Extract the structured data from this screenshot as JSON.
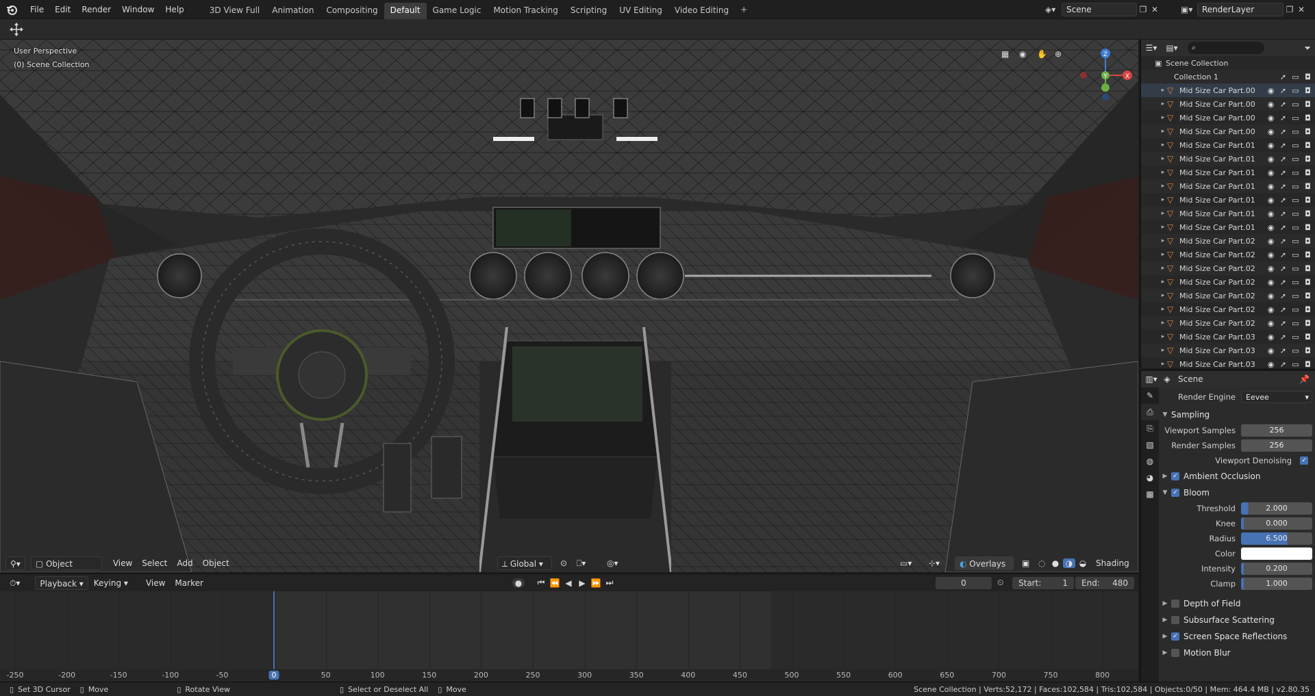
{
  "menu": [
    "File",
    "Edit",
    "Render",
    "Window",
    "Help"
  ],
  "workspaces": [
    {
      "label": "3D View Full",
      "active": false
    },
    {
      "label": "Animation",
      "active": false
    },
    {
      "label": "Compositing",
      "active": false
    },
    {
      "label": "Default",
      "active": true
    },
    {
      "label": "Game Logic",
      "active": false
    },
    {
      "label": "Motion Tracking",
      "active": false
    },
    {
      "label": "Scripting",
      "active": false
    },
    {
      "label": "UV Editing",
      "active": false
    },
    {
      "label": "Video Editing",
      "active": false
    }
  ],
  "workspace_add": "+",
  "scene": {
    "name": "Scene",
    "render_layer": "RenderLayer"
  },
  "viewport": {
    "perspective_label": "User Perspective",
    "collection_label": "(0) Scene Collection",
    "mode": "Object Mode",
    "menus": [
      "View",
      "Select",
      "Add",
      "Object"
    ],
    "orientation": "Global",
    "overlays_label": "Overlays",
    "shading_label": "Shading",
    "gizmo_axes": {
      "x": "X",
      "y": "Y",
      "z": "Z"
    }
  },
  "timeline": {
    "menus": [
      "Playback",
      "Keying",
      "View",
      "Marker"
    ],
    "current_frame": "0",
    "start_label": "Start:",
    "start": "1",
    "end_label": "End:",
    "end": "480",
    "ruler": [
      "-250",
      "-200",
      "-150",
      "-100",
      "-50",
      "0",
      "50",
      "100",
      "150",
      "200",
      "250",
      "300",
      "350",
      "400",
      "450",
      "500",
      "550",
      "600",
      "650",
      "700",
      "750",
      "800"
    ],
    "playhead_frame": 0
  },
  "status": {
    "items": [
      "Set 3D Cursor",
      "Move",
      "Rotate View",
      "Select or Deselect All",
      "Move"
    ],
    "stats": "Scene Collection | Verts:52,172 | Faces:102,584 | Tris:102,584 | Objects:0/50 | Mem: 464.4 MB | v2.80.35"
  },
  "outliner": {
    "root": "Scene Collection",
    "collection": "Collection 1",
    "objects": [
      "Mid Size Car Part.00",
      "Mid Size Car Part.00",
      "Mid Size Car Part.00",
      "Mid Size Car Part.00",
      "Mid Size Car Part.01",
      "Mid Size Car Part.01",
      "Mid Size Car Part.01",
      "Mid Size Car Part.01",
      "Mid Size Car Part.01",
      "Mid Size Car Part.01",
      "Mid Size Car Part.01",
      "Mid Size Car Part.02",
      "Mid Size Car Part.02",
      "Mid Size Car Part.02",
      "Mid Size Car Part.02",
      "Mid Size Car Part.02",
      "Mid Size Car Part.02",
      "Mid Size Car Part.02",
      "Mid Size Car Part.03",
      "Mid Size Car Part.03",
      "Mid Size Car Part.03"
    ]
  },
  "properties": {
    "context": "Scene",
    "render_engine_label": "Render Engine",
    "render_engine": "Eevee",
    "sampling": {
      "title": "Sampling",
      "viewport_samples_label": "Viewport Samples",
      "viewport_samples": "256",
      "render_samples_label": "Render Samples",
      "render_samples": "256",
      "denoise_label": "Viewport Denoising"
    },
    "ambient_occlusion": "Ambient Occlusion",
    "bloom": {
      "title": "Bloom",
      "threshold_label": "Threshold",
      "threshold": "2.000",
      "threshold_fill": 0.1,
      "knee_label": "Knee",
      "knee": "0.000",
      "knee_fill": 0.0,
      "radius_label": "Radius",
      "radius": "6.500",
      "radius_fill": 0.65,
      "color_label": "Color",
      "color": "#ffffff",
      "intensity_label": "Intensity",
      "intensity": "0.200",
      "intensity_fill": 0.0,
      "clamp_label": "Clamp",
      "clamp": "1.000",
      "clamp_fill": 0.02
    },
    "panels": [
      {
        "label": "Depth of Field",
        "checked": false
      },
      {
        "label": "Subsurface Scattering",
        "checked": false
      },
      {
        "label": "Screen Space Reflections",
        "checked": true
      },
      {
        "label": "Motion Blur",
        "checked": false
      }
    ]
  },
  "colors": {
    "accent": "#4772b3",
    "active_tab": "#3d3d3d",
    "mesh_icon": "#e08a3a"
  }
}
